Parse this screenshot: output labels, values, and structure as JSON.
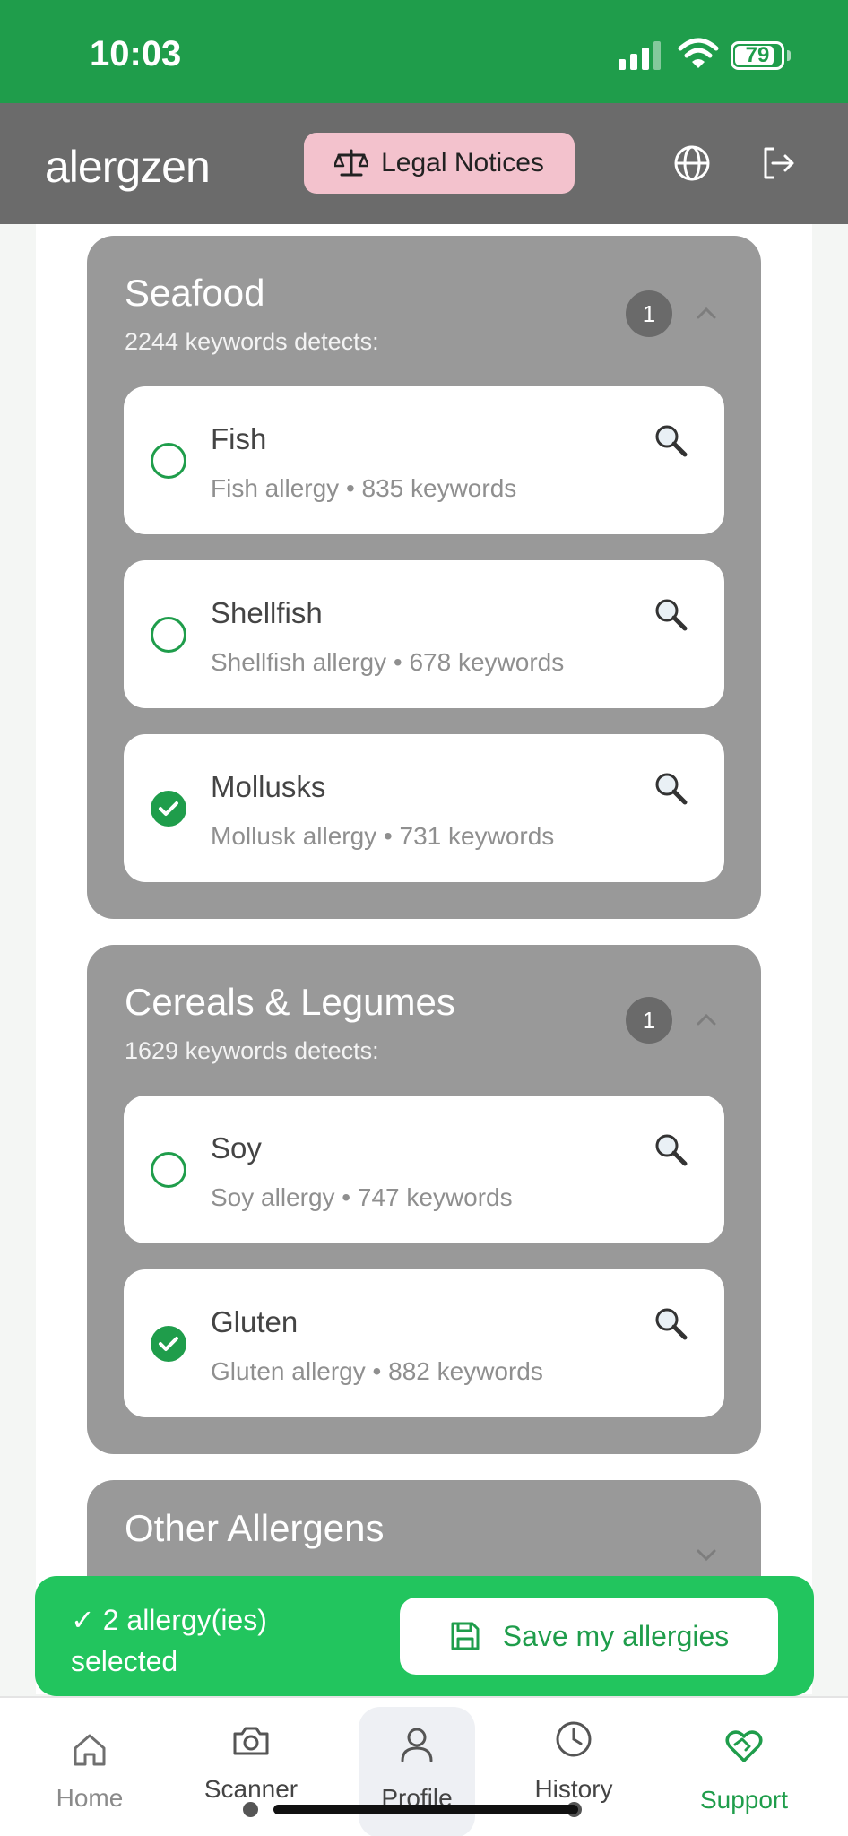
{
  "status_bar": {
    "time": "10:03",
    "battery_level": "79"
  },
  "header": {
    "logo": "alergzen",
    "legal_label": "Legal Notices"
  },
  "groups": [
    {
      "title": "Seafood",
      "subtitle": "2244 keywords detects:",
      "badge": "1",
      "expanded": true,
      "items": [
        {
          "name": "Fish",
          "desc": "Fish allergy • 835 keywords",
          "checked": false
        },
        {
          "name": "Shellfish",
          "desc": "Shellfish allergy • 678 keywords",
          "checked": false
        },
        {
          "name": "Mollusks",
          "desc": "Mollusk allergy • 731 keywords",
          "checked": true
        }
      ]
    },
    {
      "title": "Cereals & Legumes",
      "subtitle": "1629 keywords detects:",
      "badge": "1",
      "expanded": true,
      "items": [
        {
          "name": "Soy",
          "desc": "Soy allergy • 747 keywords",
          "checked": false
        },
        {
          "name": "Gluten",
          "desc": "Gluten allergy • 882 keywords",
          "checked": true
        }
      ]
    },
    {
      "title": "Other Allergens",
      "expanded": false
    }
  ],
  "selection": {
    "text": "✓ 2 allergy(ies) selected",
    "save_label": "Save my allergies"
  },
  "tabs": [
    {
      "label": "Home",
      "icon": "home-icon"
    },
    {
      "label": "Scanner",
      "icon": "camera-icon"
    },
    {
      "label": "Profile",
      "icon": "user-icon",
      "active": true
    },
    {
      "label": "History",
      "icon": "clock-icon"
    },
    {
      "label": "Support",
      "icon": "heart-handshake-icon"
    }
  ],
  "colors": {
    "brand_green": "#1f9d4b",
    "select_green": "#22c55e",
    "header_gray": "#6b6b6b",
    "group_gray": "#999999",
    "legal_pink": "#f3c2cd"
  }
}
